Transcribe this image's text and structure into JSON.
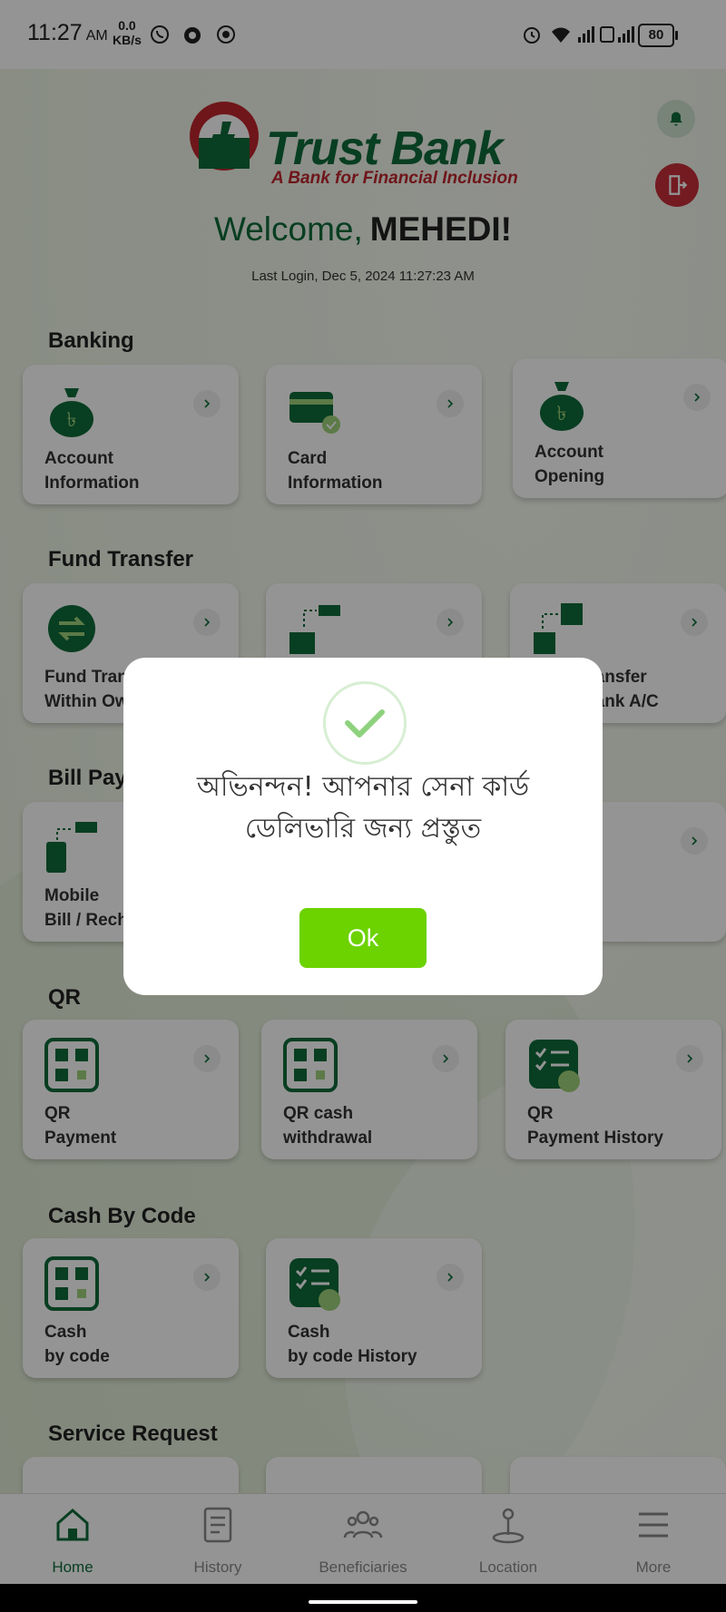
{
  "status_bar": {
    "time": "11:27",
    "ampm": "AM",
    "net_speed_value": "0.0",
    "net_speed_unit": "KB/s",
    "battery": "80"
  },
  "header": {
    "bank_name": "Trust Bank",
    "tagline": "A Bank for Financial Inclusion",
    "welcome": "Welcome,",
    "user_name": "MEHEDI!",
    "last_login": "Last Login, Dec 5, 2024 11:27:23 AM"
  },
  "sections": {
    "banking": "Banking",
    "fund_transfer": "Fund Transfer",
    "bill_payment": "Bill Payment",
    "qr": "QR",
    "cash_by_code": "Cash By Code",
    "service_request": "Service Request"
  },
  "cards": {
    "account_information": "Account\nInformation",
    "card_information": "Card\nInformation",
    "account_opening": "Account\nOpening",
    "fund_transfer_own": "Fund Transfer\nWithin Own A/C",
    "fund_transfer_other": "Fund Transfer\nOther Bank A/C",
    "mobile_bill": "Mobile\nBill / Recharge",
    "qr_payment": "QR\nPayment",
    "qr_cash_withdrawal": "QR cash\n withdrawal",
    "qr_payment_history": "QR\nPayment History",
    "cash_by_code": "Cash\n by code",
    "cash_by_code_history": "Cash\nby code History"
  },
  "bottom_nav": [
    {
      "label": "Home"
    },
    {
      "label": "History"
    },
    {
      "label": "Beneficiaries"
    },
    {
      "label": "Location"
    },
    {
      "label": "More"
    }
  ],
  "dialog": {
    "message": "অভিনন্দন! আপনার সেনা কার্ড ডেলিভারি জন্য প্রস্তুত",
    "ok_label": "Ok"
  },
  "colors": {
    "brand_green": "#0e6b3a",
    "brand_red": "#c0262d",
    "ok_button": "#6cd200"
  }
}
